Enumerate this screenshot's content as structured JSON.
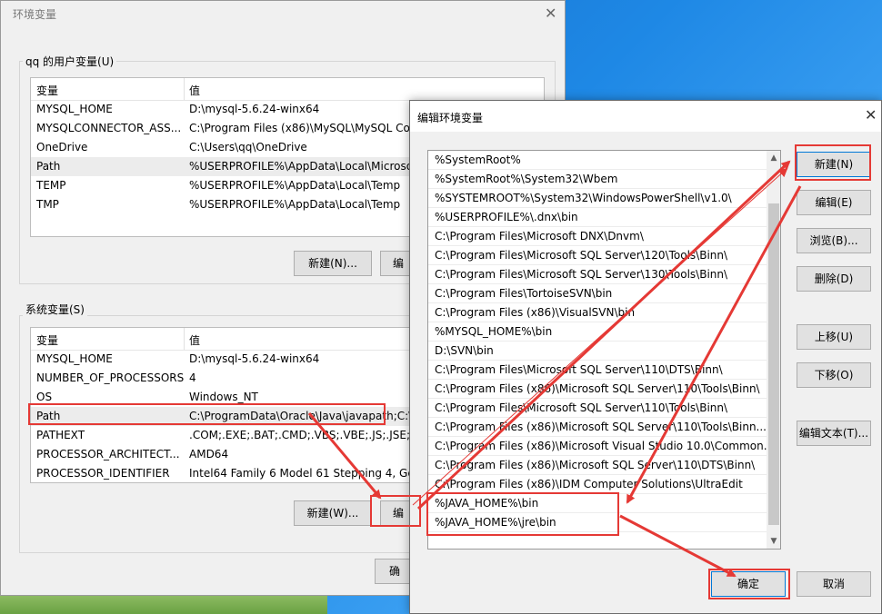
{
  "env_dialog": {
    "title": "环境变量",
    "close_glyph": "✕",
    "user_group_label": "qq 的用户变量(U)",
    "system_group_label": "系统变量(S)",
    "col_variable": "变量",
    "col_value": "值",
    "user_vars": [
      {
        "name": "MYSQL_HOME",
        "value": "D:\\mysql-5.6.24-winx64"
      },
      {
        "name": "MYSQLCONNECTOR_ASS...",
        "value": "C:\\Program Files (x86)\\MySQL\\MySQL Co"
      },
      {
        "name": "OneDrive",
        "value": "C:\\Users\\qq\\OneDrive"
      },
      {
        "name": "Path",
        "value": "%USERPROFILE%\\AppData\\Local\\Microso"
      },
      {
        "name": "TEMP",
        "value": "%USERPROFILE%\\AppData\\Local\\Temp"
      },
      {
        "name": "TMP",
        "value": "%USERPROFILE%\\AppData\\Local\\Temp"
      }
    ],
    "system_vars": [
      {
        "name": "MYSQL_HOME",
        "value": "D:\\mysql-5.6.24-winx64"
      },
      {
        "name": "NUMBER_OF_PROCESSORS",
        "value": "4"
      },
      {
        "name": "OS",
        "value": "Windows_NT"
      },
      {
        "name": "Path",
        "value": "C:\\ProgramData\\Oracle\\Java\\javapath;C:\\"
      },
      {
        "name": "PATHEXT",
        "value": ".COM;.EXE;.BAT;.CMD;.VBS;.VBE;.JS;.JSE;.W"
      },
      {
        "name": "PROCESSOR_ARCHITECT...",
        "value": "AMD64"
      },
      {
        "name": "PROCESSOR_IDENTIFIER",
        "value": "Intel64 Family 6 Model 61 Stepping 4, Ge"
      }
    ],
    "user_new_button": "新建(N)...",
    "user_edit_button": "编",
    "system_new_button": "新建(W)...",
    "system_edit_button": "编",
    "ok_button": "确"
  },
  "edit_dialog": {
    "title": "编辑环境变量",
    "close_glyph": "✕",
    "entries": [
      "%SystemRoot%",
      "%SystemRoot%\\System32\\Wbem",
      "%SYSTEMROOT%\\System32\\WindowsPowerShell\\v1.0\\",
      "%USERPROFILE%\\.dnx\\bin",
      "C:\\Program Files\\Microsoft DNX\\Dnvm\\",
      "C:\\Program Files\\Microsoft SQL Server\\120\\Tools\\Binn\\",
      "C:\\Program Files\\Microsoft SQL Server\\130\\Tools\\Binn\\",
      "C:\\Program Files\\TortoiseSVN\\bin",
      "C:\\Program Files (x86)\\VisualSVN\\bin",
      "%MYSQL_HOME%\\bin",
      "D:\\SVN\\bin",
      "C:\\Program Files\\Microsoft SQL Server\\110\\DTS\\Binn\\",
      "C:\\Program Files (x86)\\Microsoft SQL Server\\110\\Tools\\Binn\\",
      "C:\\Program Files\\Microsoft SQL Server\\110\\Tools\\Binn\\",
      "C:\\Program Files (x86)\\Microsoft SQL Server\\110\\Tools\\Binn...",
      "C:\\Program Files (x86)\\Microsoft Visual Studio 10.0\\Common...",
      "C:\\Program Files (x86)\\Microsoft SQL Server\\110\\DTS\\Binn\\",
      "C:\\Program Files (x86)\\IDM Computer Solutions\\UltraEdit",
      "%JAVA_HOME%\\bin",
      "%JAVA_HOME%\\jre\\bin"
    ],
    "buttons": {
      "new": "新建(N)",
      "edit": "编辑(E)",
      "browse": "浏览(B)...",
      "delete": "删除(D)",
      "move_up": "上移(U)",
      "move_down": "下移(O)",
      "edit_text": "编辑文本(T)...",
      "ok": "确定",
      "cancel": "取消"
    },
    "scroll_up_glyph": "▲",
    "scroll_down_glyph": "▼"
  },
  "annotation_color": "#e53935"
}
